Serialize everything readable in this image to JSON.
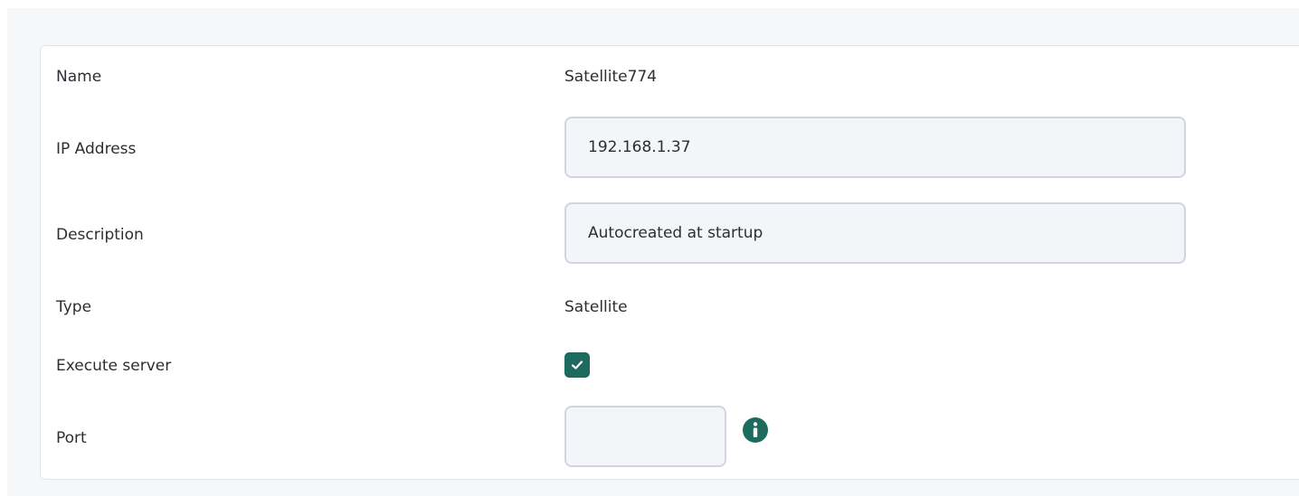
{
  "fields": {
    "name": {
      "label": "Name",
      "value": "Satellite774"
    },
    "ip_address": {
      "label": "IP Address",
      "value": "192.168.1.37"
    },
    "description": {
      "label": "Description",
      "value": "Autocreated at startup"
    },
    "type": {
      "label": "Type",
      "value": "Satellite"
    },
    "execute_server": {
      "label": "Execute server",
      "checked": true
    },
    "port": {
      "label": "Port",
      "value": ""
    }
  },
  "colors": {
    "accent": "#1d6b5f",
    "input_bg": "#f3f5f8",
    "input_border": "#cfd6df"
  },
  "icons": {
    "checkbox": "check-icon",
    "port_help": "info-icon"
  }
}
